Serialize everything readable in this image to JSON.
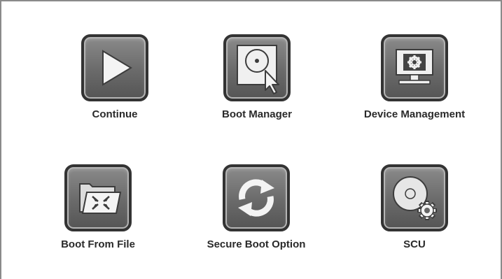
{
  "menu": {
    "items": [
      {
        "label": "Continue",
        "icon": "play-icon"
      },
      {
        "label": "Boot Manager",
        "icon": "disc-cursor-icon"
      },
      {
        "label": "Device Management",
        "icon": "monitor-gear-icon"
      },
      {
        "label": "Boot From File",
        "icon": "folder-compress-icon"
      },
      {
        "label": "Secure Boot Option",
        "icon": "refresh-icon"
      },
      {
        "label": "SCU",
        "icon": "disc-gear-icon"
      }
    ]
  },
  "colors": {
    "tile_border": "#333333",
    "tile_fill": "#6a6a6a",
    "label_text": "#2a2a2a",
    "frame_border": "#8a8a8a"
  }
}
